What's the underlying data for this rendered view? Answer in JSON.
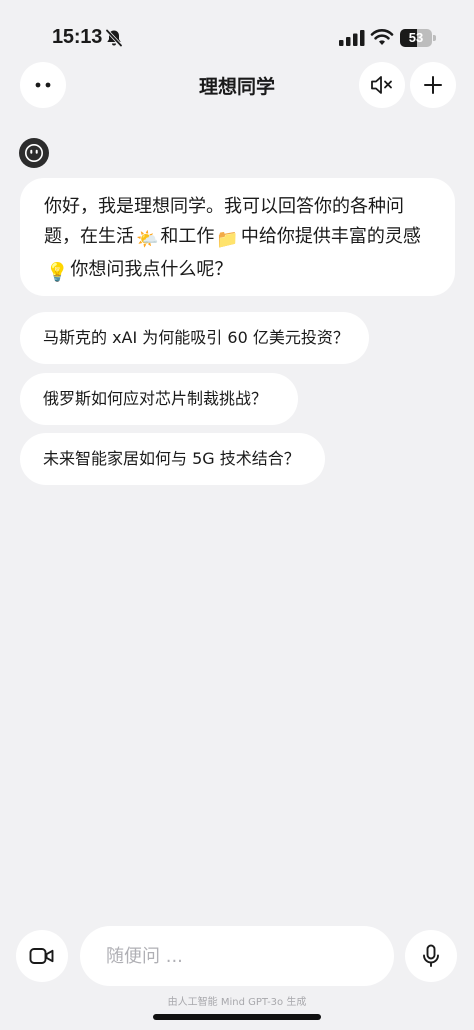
{
  "status_bar": {
    "time": "15:13",
    "battery_percent": "53",
    "battery_level": 0.53,
    "icons": [
      "bell-slash-icon",
      "cellular-signal-icon",
      "wifi-icon",
      "battery-icon"
    ]
  },
  "nav": {
    "title": "理想同学",
    "icons": [
      "dots-menu-icon",
      "speaker-muted-icon",
      "plus-icon"
    ]
  },
  "chat": {
    "avatar_icon": "robot-face-icon",
    "greeting": {
      "part1": "你好，我是理想同学。我可以回答你的各种问题，在生活",
      "emoji1": "🌤️",
      "part2": "和工作",
      "emoji2": "📁",
      "part3": "中给你提供丰富的灵感",
      "emoji3": "💡",
      "part4": "你想问我点什么呢？"
    },
    "suggestions": [
      "马斯克的 xAI 为何能吸引 60 亿美元投资？",
      "俄罗斯如何应对芯片制裁挑战？",
      "未来智能家居如何与 5G 技术结合？"
    ]
  },
  "input_bar": {
    "placeholder": "随便问 ...",
    "value": "",
    "icons": [
      "video-camera-icon",
      "microphone-icon"
    ]
  },
  "footer": {
    "note": "由人工智能 Mind GPT-3o 生成"
  },
  "colors": {
    "background": "#f1f1f3",
    "surface": "#ffffff",
    "text": "#1a1a1a",
    "placeholder": "#b0b0b5",
    "avatar": "#2c2c2c"
  }
}
